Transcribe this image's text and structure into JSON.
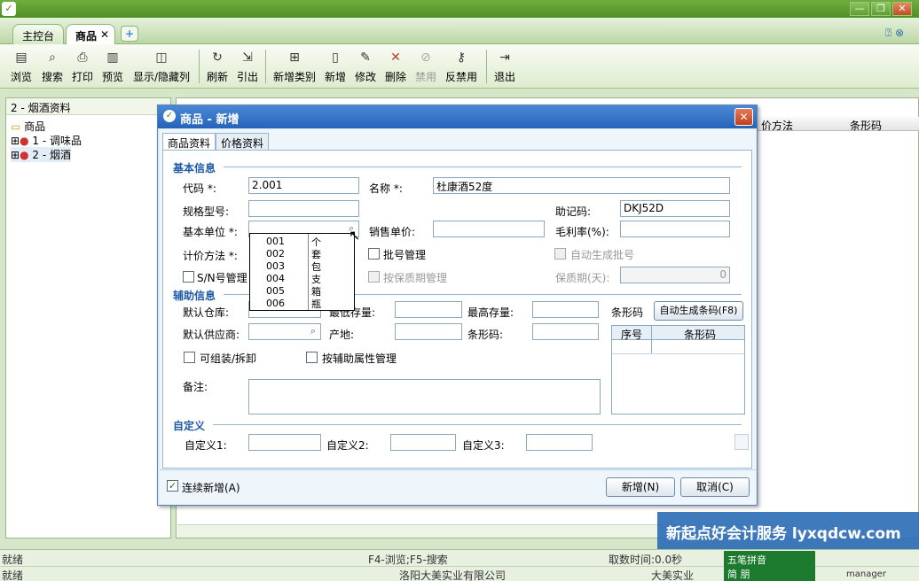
{
  "window": {
    "title": "",
    "extra": "",
    "buttons": [
      "—",
      "❐",
      "✕"
    ]
  },
  "tabs": [
    {
      "label": "主控台"
    },
    {
      "label": "商品"
    }
  ],
  "toolbar": [
    {
      "label": "浏览",
      "icon": "browse-icon",
      "glyph": "▤"
    },
    {
      "label": "搜索",
      "icon": "search-icon",
      "glyph": "⌕"
    },
    {
      "label": "打印",
      "icon": "print-icon",
      "glyph": "⎙"
    },
    {
      "label": "预览",
      "icon": "preview-icon",
      "glyph": "▥"
    },
    {
      "label": "显示/隐藏列",
      "icon": "columns-icon",
      "glyph": "◫"
    },
    {
      "label": "刷新",
      "icon": "refresh-icon",
      "glyph": "↻"
    },
    {
      "label": "引出",
      "icon": "export-icon",
      "glyph": "⇲"
    },
    {
      "label": "新增类别",
      "icon": "add-category-icon",
      "glyph": "⊞"
    },
    {
      "label": "新增",
      "icon": "new-icon",
      "glyph": "▯"
    },
    {
      "label": "修改",
      "icon": "edit-icon",
      "glyph": "✎"
    },
    {
      "label": "删除",
      "icon": "delete-icon",
      "glyph": "✕"
    },
    {
      "label": "禁用",
      "icon": "disable-icon",
      "glyph": "⊘"
    },
    {
      "label": "反禁用",
      "icon": "enable-icon",
      "glyph": "⚷"
    },
    {
      "label": "退出",
      "icon": "exit-icon",
      "glyph": "⇥"
    }
  ],
  "left": {
    "title": "2 - 烟酒资料",
    "tree": [
      "商品",
      "1 - 调味品",
      "2 - 烟酒"
    ]
  },
  "grid": {
    "cols": [
      "价方法",
      "条形码"
    ]
  },
  "dialog": {
    "title": "商品 - 新增",
    "tabs": [
      "商品资料",
      "价格资料"
    ],
    "sections": {
      "basic": "基本信息",
      "aux": "辅助信息",
      "custom": "自定义"
    },
    "fields": {
      "code": {
        "label": "代码 *:",
        "value": "2.001"
      },
      "name": {
        "label": "名称 *:",
        "value": "杜康酒52度"
      },
      "spec": {
        "label": "规格型号:",
        "value": ""
      },
      "mnemonic": {
        "label": "助记码:",
        "value": "DKJ52D"
      },
      "unit": {
        "label": "基本单位 *:",
        "value": ""
      },
      "sale_unit": {
        "label": "销售单价:",
        "value": ""
      },
      "margin": {
        "label": "毛利率(%):",
        "value": ""
      },
      "cost": {
        "label": "计价方法 *:"
      },
      "batch": {
        "label": "批号管理"
      },
      "auto_batch": {
        "label": "自动生成批号"
      },
      "sn": {
        "label": "S/N号管理"
      },
      "shelf": {
        "label": "按保质期管理"
      },
      "shelf_days": {
        "label": "保质期(天):",
        "value": "0"
      },
      "warehouse": {
        "label": "默认仓库:"
      },
      "min_stock": {
        "label": "最低存量:"
      },
      "max_stock": {
        "label": "最高存量:"
      },
      "barcode_label": {
        "label": "条形码"
      },
      "supplier": {
        "label": "默认供应商:"
      },
      "origin": {
        "label": "产地:"
      },
      "barcode": {
        "label": "条形码:"
      },
      "assemble": {
        "label": "可组装/拆卸"
      },
      "aux_attr": {
        "label": "按辅助属性管理"
      },
      "remark": {
        "label": "备注:"
      },
      "c1": {
        "label": "自定义1:"
      },
      "c2": {
        "label": "自定义2:"
      },
      "c3": {
        "label": "自定义3:"
      }
    },
    "auto_barcode_button": "自动生成条码(F8)",
    "barcode_table": {
      "cols": [
        "序号",
        "条形码"
      ]
    },
    "continue_label": "连续新增(A)",
    "add_button": "新增(N)",
    "cancel_button": "取消(C)"
  },
  "dropdown": [
    {
      "code": "001",
      "unit": "个"
    },
    {
      "code": "002",
      "unit": "套"
    },
    {
      "code": "003",
      "unit": "包"
    },
    {
      "code": "004",
      "unit": "支"
    },
    {
      "code": "005",
      "unit": "箱"
    },
    {
      "code": "006",
      "unit": "瓶"
    }
  ],
  "status": {
    "ready": "就绪",
    "hint": "F4-浏览;F5-搜索",
    "time": "取数时间:0.0秒",
    "company": "洛阳大美实业有限公司",
    "company_short": "大美实业",
    "user": "manager"
  },
  "watermark": "新起点好会计服务 lyxqdcw.com",
  "ime": {
    "line1": "五笔拼音",
    "line2": "简 朋"
  }
}
